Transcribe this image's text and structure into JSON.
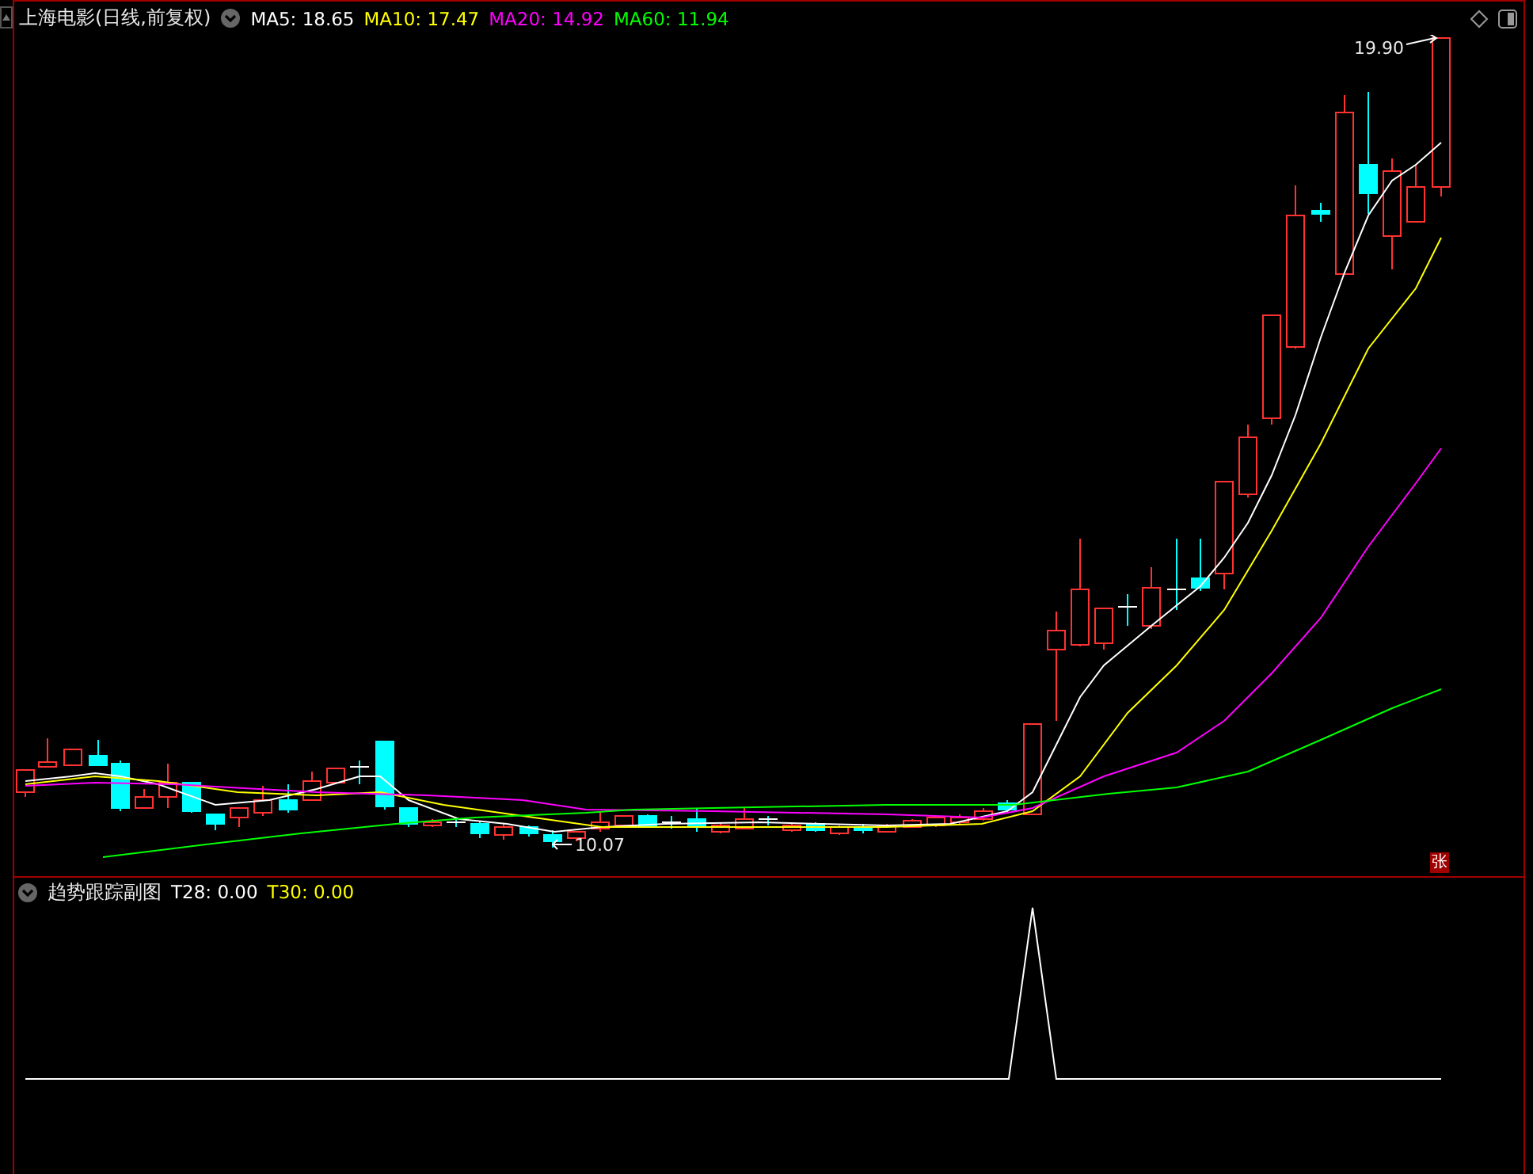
{
  "main_panel": {
    "title": "上海电影(日线,前复权)",
    "indicators": [
      {
        "label": "MA5: 18.65",
        "color": "#ffffff"
      },
      {
        "label": "MA10: 17.47",
        "color": "#ffff00"
      },
      {
        "label": "MA20: 14.92",
        "color": "#ff00ff"
      },
      {
        "label": "MA60: 11.94",
        "color": "#00ff00"
      }
    ],
    "high_label": "19.90",
    "low_label": "10.07",
    "badge": "张"
  },
  "sub_panel": {
    "title": "趋势跟踪副图",
    "indicators": [
      {
        "label": "T28: 0.00",
        "color": "#ffffff"
      },
      {
        "label": "T30: 0.00",
        "color": "#ffff00"
      }
    ]
  }
}
